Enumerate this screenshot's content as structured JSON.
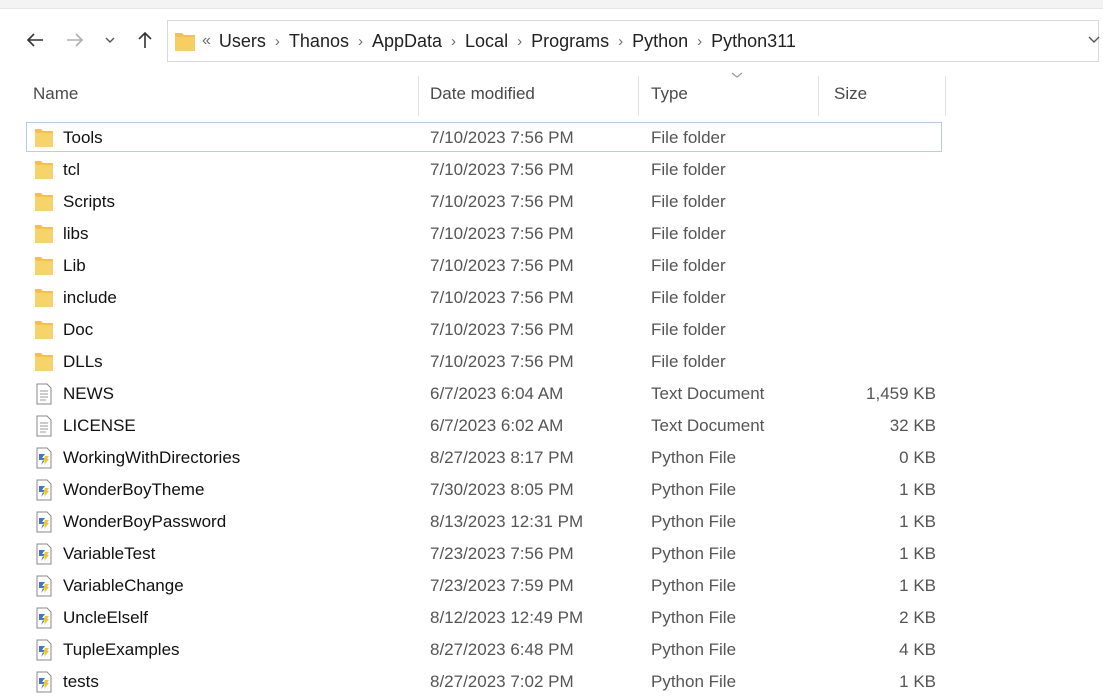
{
  "address_bar": {
    "overflow": "«",
    "breadcrumbs": [
      "Users",
      "Thanos",
      "AppData",
      "Local",
      "Programs",
      "Python",
      "Python311"
    ]
  },
  "columns": {
    "name": "Name",
    "date_modified": "Date modified",
    "type": "Type",
    "size": "Size"
  },
  "colors": {
    "folder": "#f2c14e",
    "selection_border": "#b5cdea",
    "python_icon_blue": "#3d7ab8",
    "python_icon_yellow": "#f4c430"
  },
  "files": [
    {
      "name": "Tools",
      "date": "7/10/2023 7:56 PM",
      "type": "File folder",
      "size": "",
      "icon": "folder-icon",
      "selected": true
    },
    {
      "name": "tcl",
      "date": "7/10/2023 7:56 PM",
      "type": "File folder",
      "size": "",
      "icon": "folder-icon"
    },
    {
      "name": "Scripts",
      "date": "7/10/2023 7:56 PM",
      "type": "File folder",
      "size": "",
      "icon": "folder-icon"
    },
    {
      "name": "libs",
      "date": "7/10/2023 7:56 PM",
      "type": "File folder",
      "size": "",
      "icon": "folder-icon"
    },
    {
      "name": "Lib",
      "date": "7/10/2023 7:56 PM",
      "type": "File folder",
      "size": "",
      "icon": "folder-icon"
    },
    {
      "name": "include",
      "date": "7/10/2023 7:56 PM",
      "type": "File folder",
      "size": "",
      "icon": "folder-icon"
    },
    {
      "name": "Doc",
      "date": "7/10/2023 7:56 PM",
      "type": "File folder",
      "size": "",
      "icon": "folder-icon"
    },
    {
      "name": "DLLs",
      "date": "7/10/2023 7:56 PM",
      "type": "File folder",
      "size": "",
      "icon": "folder-icon"
    },
    {
      "name": "NEWS",
      "date": "6/7/2023 6:04 AM",
      "type": "Text Document",
      "size": "1,459 KB",
      "icon": "text-document-icon"
    },
    {
      "name": "LICENSE",
      "date": "6/7/2023 6:02 AM",
      "type": "Text Document",
      "size": "32 KB",
      "icon": "text-document-icon"
    },
    {
      "name": "WorkingWithDirectories",
      "date": "8/27/2023 8:17 PM",
      "type": "Python File",
      "size": "0 KB",
      "icon": "python-file-icon"
    },
    {
      "name": "WonderBoyTheme",
      "date": "7/30/2023 8:05 PM",
      "type": "Python File",
      "size": "1 KB",
      "icon": "python-file-icon"
    },
    {
      "name": "WonderBoyPassword",
      "date": "8/13/2023 12:31 PM",
      "type": "Python File",
      "size": "1 KB",
      "icon": "python-file-icon"
    },
    {
      "name": "VariableTest",
      "date": "7/23/2023 7:56 PM",
      "type": "Python File",
      "size": "1 KB",
      "icon": "python-file-icon"
    },
    {
      "name": "VariableChange",
      "date": "7/23/2023 7:59 PM",
      "type": "Python File",
      "size": "1 KB",
      "icon": "python-file-icon"
    },
    {
      "name": "UncleElself",
      "date": "8/12/2023 12:49 PM",
      "type": "Python File",
      "size": "2 KB",
      "icon": "python-file-icon"
    },
    {
      "name": "TupleExamples",
      "date": "8/27/2023 6:48 PM",
      "type": "Python File",
      "size": "4 KB",
      "icon": "python-file-icon"
    },
    {
      "name": "tests",
      "date": "8/27/2023 7:02 PM",
      "type": "Python File",
      "size": "1 KB",
      "icon": "python-file-icon"
    }
  ]
}
